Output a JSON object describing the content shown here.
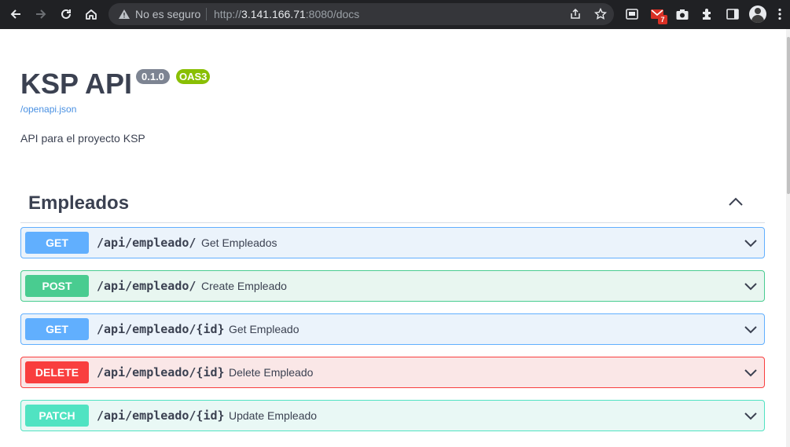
{
  "browser": {
    "security_text": "No es seguro",
    "url_prefix": "http://",
    "url_host": "3.141.166.71",
    "url_rest": ":8080/docs",
    "mail_badge_count": "7"
  },
  "colors": {
    "get": "#61affe",
    "post": "#49cc90",
    "delete": "#f93e3e",
    "patch": "#50e3c2",
    "version_badge": "#7d8492",
    "oas_badge": "#89bf04"
  },
  "info": {
    "title": "KSP API",
    "version": "0.1.0",
    "oas": "OAS3",
    "spec_link": "/openapi.json",
    "description": "API para el proyecto KSP"
  },
  "tag": {
    "name": "Empleados",
    "operations": [
      {
        "method": "GET",
        "path": "/api/empleado/",
        "summary": "Get Empleados"
      },
      {
        "method": "POST",
        "path": "/api/empleado/",
        "summary": "Create Empleado"
      },
      {
        "method": "GET",
        "path": "/api/empleado/{id}",
        "summary": "Get Empleado"
      },
      {
        "method": "DELETE",
        "path": "/api/empleado/{id}",
        "summary": "Delete Empleado"
      },
      {
        "method": "PATCH",
        "path": "/api/empleado/{id}",
        "summary": "Update Empleado"
      }
    ]
  }
}
